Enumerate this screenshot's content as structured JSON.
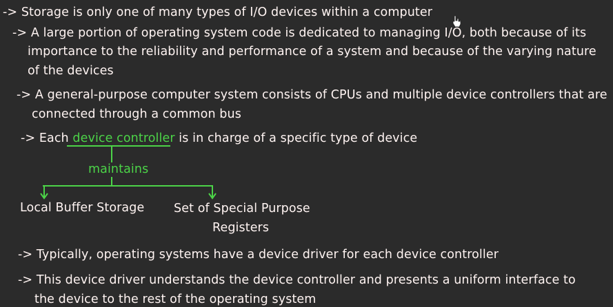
{
  "bullets": {
    "b1": "-> Storage is only one of many types of I/O devices within a computer",
    "b2_l1": "-> A large portion of operating system code is dedicated to managing I/O, both because of its",
    "b2_l2": "importance to the reliability and performance of a system and because of the varying nature",
    "b2_l3": "of the devices",
    "b3_l1": "-> A general-purpose computer system consists of CPUs and multiple device controllers that are",
    "b3_l2": "connected through a common bus",
    "b4_prefix": "-> Each ",
    "b4_highlight": "device controller",
    "b4_suffix": " is in charge of a specific type of device",
    "b5": "-> Typically, operating systems have a device driver for each device controller",
    "b6_l1": "-> This device driver understands the device controller and presents a uniform interface to",
    "b6_l2": "the device to the rest of the operating system"
  },
  "diagram": {
    "relation": "maintains",
    "left_child": "Local Buffer Storage",
    "right_child_l1": "Set of Special Purpose",
    "right_child_l2": "Registers"
  },
  "colors": {
    "background": "#2b2b2b",
    "text": "#fff3f3",
    "accent": "#4cd448"
  }
}
